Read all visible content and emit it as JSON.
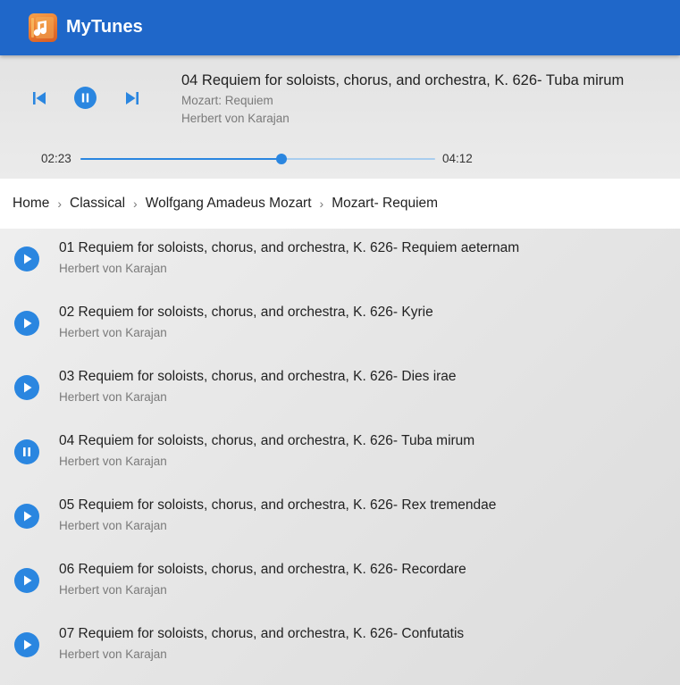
{
  "app": {
    "title": "MyTunes",
    "accent_color": "#1f67c9",
    "logo_icon": "music-note-icon"
  },
  "player": {
    "title": "04 Requiem for soloists, chorus, and orchestra, K. 626- Tuba mirum",
    "album": "Mozart: Requiem",
    "artist": "Herbert von Karajan",
    "current_time": "02:23",
    "total_time": "04:12",
    "progress_fraction": 0.5675,
    "state": "playing",
    "controls": [
      "previous-icon",
      "pause-icon",
      "next-icon"
    ]
  },
  "breadcrumb": {
    "items": [
      "Home",
      "Classical",
      "Wolfgang Amadeus Mozart",
      "Mozart- Requiem"
    ],
    "separator": "›"
  },
  "tracks": [
    {
      "title": "01 Requiem for soloists, chorus, and orchestra, K. 626- Requiem aeternam",
      "artist": "Herbert von Karajan",
      "icon": "play-icon"
    },
    {
      "title": "02 Requiem for soloists, chorus, and orchestra, K. 626- Kyrie",
      "artist": "Herbert von Karajan",
      "icon": "play-icon"
    },
    {
      "title": "03 Requiem for soloists, chorus, and orchestra, K. 626- Dies irae",
      "artist": "Herbert von Karajan",
      "icon": "play-icon"
    },
    {
      "title": "04 Requiem for soloists, chorus, and orchestra, K. 626- Tuba mirum",
      "artist": "Herbert von Karajan",
      "icon": "pause-icon"
    },
    {
      "title": "05 Requiem for soloists, chorus, and orchestra, K. 626- Rex tremendae",
      "artist": "Herbert von Karajan",
      "icon": "play-icon"
    },
    {
      "title": "06 Requiem for soloists, chorus, and orchestra, K. 626- Recordare",
      "artist": "Herbert von Karajan",
      "icon": "play-icon"
    },
    {
      "title": "07 Requiem for soloists, chorus, and orchestra, K. 626- Confutatis",
      "artist": "Herbert von Karajan",
      "icon": "play-icon"
    }
  ]
}
